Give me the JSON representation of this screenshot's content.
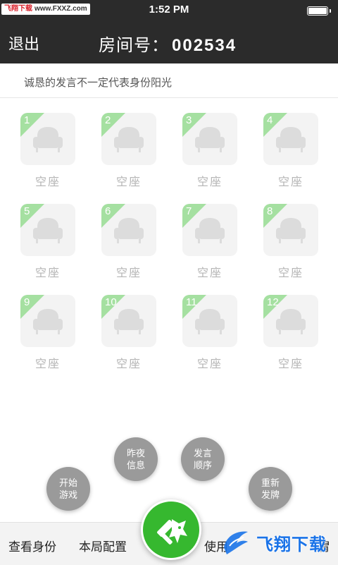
{
  "status_bar": {
    "watermark_site": "飞翔下载",
    "watermark_url": "www.FXXZ.com",
    "time": "1:52 PM",
    "battery_level": 1.0
  },
  "header": {
    "exit_label": "退出",
    "room_label": "房间号：",
    "room_number": "002534"
  },
  "notice": "诚恳的发言不一定代表身份阳光",
  "seats": [
    {
      "number": "1",
      "label": "空座"
    },
    {
      "number": "2",
      "label": "空座"
    },
    {
      "number": "3",
      "label": "空座"
    },
    {
      "number": "4",
      "label": "空座"
    },
    {
      "number": "5",
      "label": "空座"
    },
    {
      "number": "6",
      "label": "空座"
    },
    {
      "number": "7",
      "label": "空座"
    },
    {
      "number": "8",
      "label": "空座"
    },
    {
      "number": "9",
      "label": "空座"
    },
    {
      "number": "10",
      "label": "空座"
    },
    {
      "number": "11",
      "label": "空座"
    },
    {
      "number": "12",
      "label": "空座"
    }
  ],
  "actions": {
    "start_game": "开始游戏",
    "last_night": "昨夜信息",
    "speak_order": "发言顺序",
    "redeal": "重新发牌"
  },
  "bottom_bar": {
    "check_identity": "查看身份",
    "game_config": "本局配置",
    "use_partial": "使用",
    "partial_tail": "胃"
  },
  "watermark_bottom": "飞翔下载",
  "colors": {
    "header_bg": "#2b2b2b",
    "seat_corner": "#a5e0a1",
    "primary_green": "#36b82f",
    "action_gray": "#9a9a9a"
  },
  "icons": {
    "seat": "sofa-icon",
    "center": "wolf-hammer-icon"
  }
}
